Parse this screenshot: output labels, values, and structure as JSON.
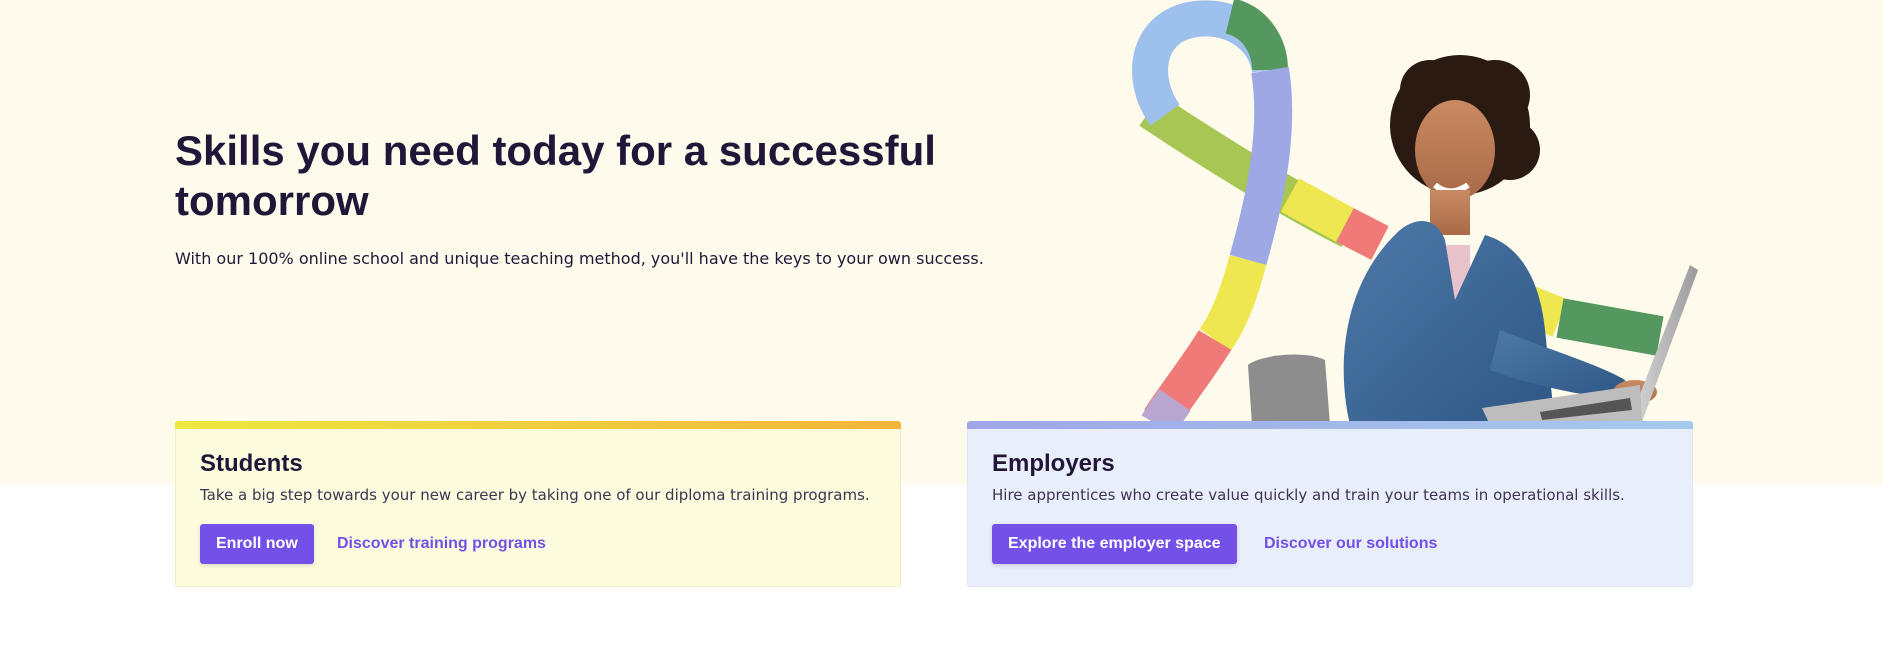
{
  "hero": {
    "title": "Skills you need today for a successful tomorrow",
    "subtitle": "With our 100% online school and unique teaching method, you'll have the keys to your own success.",
    "background": "#fefaec"
  },
  "illustration": {
    "subject": "person-with-laptop-and-ribbon",
    "ribbon_colors": [
      "#9ec0ec",
      "#55985f",
      "#a8c653",
      "#eee74f",
      "#f07a78",
      "#9ea8e4"
    ]
  },
  "cards": {
    "students": {
      "title": "Students",
      "description": "Take a big step towards your new career by taking one of our diploma training programs.",
      "primary_button": "Enroll now",
      "secondary_link": "Discover training programs",
      "accent_gradient": [
        "#ede83f",
        "#f4b43c"
      ],
      "background": "#fdfbdd"
    },
    "employers": {
      "title": "Employers",
      "description": "Hire apprentices who create value quickly and train your teams in operational skills.",
      "primary_button": "Explore the employer space",
      "secondary_link": "Discover our solutions",
      "accent_gradient": [
        "#9fa6e8",
        "#a6caee"
      ],
      "background": "#e9eefb"
    }
  },
  "colors": {
    "primary": "#7350e8",
    "heading": "#221638"
  }
}
